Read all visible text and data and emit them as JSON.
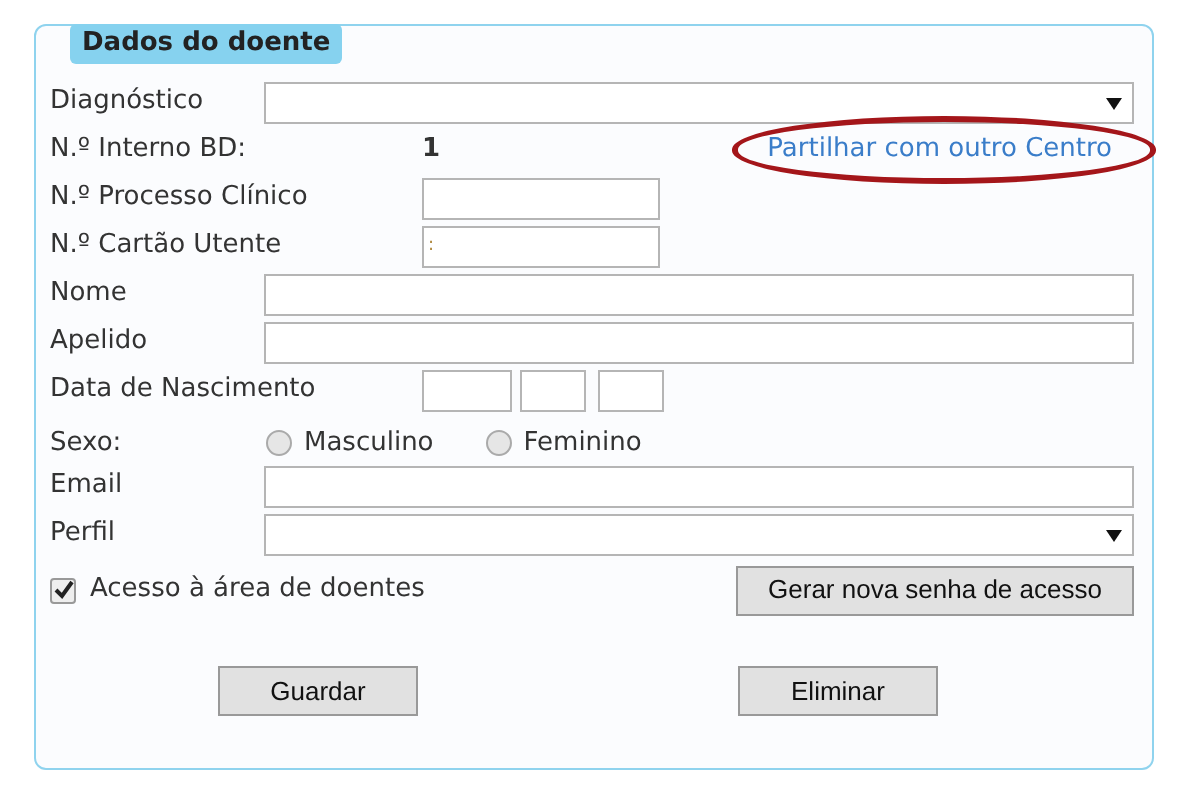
{
  "panel": {
    "title": "Dados do doente"
  },
  "fields": [
    {
      "kind": "select",
      "label": "Diagnóstico"
    },
    {
      "kind": "value",
      "label": "N.º Interno BD:",
      "value": "1",
      "link": {
        "label": "Partilhar com outro Centro",
        "circled": true
      }
    },
    {
      "kind": "short",
      "label": "N.º Processo Clínico"
    },
    {
      "kind": "short",
      "label": "N.º Cartão Utente",
      "value": ":"
    },
    {
      "kind": "text",
      "label": "Nome"
    },
    {
      "kind": "text",
      "label": "Apelido"
    },
    {
      "kind": "date",
      "label": "Data de Nascimento"
    },
    {
      "kind": "radio",
      "label": "Sexo:",
      "options": [
        {
          "label": "Masculino",
          "selected": false
        },
        {
          "label": "Feminino",
          "selected": false
        }
      ]
    },
    {
      "kind": "text",
      "label": "Email"
    },
    {
      "kind": "select",
      "label": "Perfil"
    }
  ],
  "access": {
    "label": "Acesso à área de doentes",
    "checked": true,
    "button": "Gerar nova senha de acesso"
  },
  "buttons": [
    "Guardar",
    "Eliminar"
  ]
}
